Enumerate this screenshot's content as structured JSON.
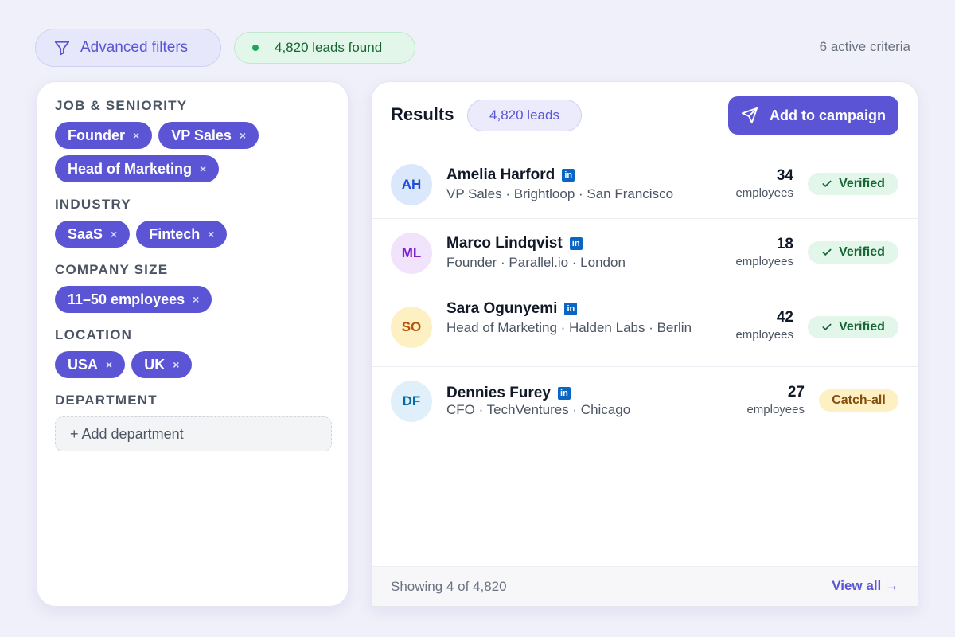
{
  "header": {
    "filters_label": "Advanced filters",
    "leads_found": "4,820 leads found",
    "active_criteria": "6 active criteria"
  },
  "filters": {
    "sections": [
      {
        "title": "JOB & SENIORITY",
        "chips": [
          "Founder",
          "VP Sales",
          "Head of Marketing"
        ]
      },
      {
        "title": "INDUSTRY",
        "chips": [
          "SaaS",
          "Fintech"
        ]
      },
      {
        "title": "COMPANY SIZE",
        "chips": [
          "11–50 employees"
        ]
      },
      {
        "title": "LOCATION",
        "chips": [
          "USA",
          "UK"
        ]
      },
      {
        "title": "DEPARTMENT",
        "chips": []
      }
    ],
    "remove_glyph": "×",
    "add_department": "+ Add department"
  },
  "results": {
    "title": "Results",
    "count_label": "4,820 leads",
    "campaign_label": "Add to campaign",
    "linkedin_glyph": "in",
    "check_glyph": "✓",
    "leads": [
      {
        "initials": "AH",
        "name": "Amelia Harford",
        "meta": "VP Sales · Brightloop · San Francisco",
        "employees": "34",
        "employees_label": "employees",
        "status": "Verified"
      },
      {
        "initials": "ML",
        "name": "Marco Lindqvist",
        "meta": "Founder · Parallel.io · London",
        "employees": "18",
        "employees_label": "employees",
        "status": "Verified"
      },
      {
        "initials": "SO",
        "name": "Sara Ogunyemi",
        "meta": "Head of Marketing · Halden Labs · Berlin",
        "employees": "42",
        "employees_label": "employees",
        "status": "Verified"
      },
      {
        "initials": "DF",
        "name": "Dennies Furey",
        "meta": "CFO · TechVentures · Chicago",
        "employees": "27",
        "employees_label": "employees",
        "status": "Catch-all"
      }
    ],
    "showing": "Showing 4 of 4,820",
    "view_all": "View all →"
  },
  "colors": {
    "accent": "#5b55d6",
    "verified_bg": "#e3f6ea",
    "verified_text": "#166534",
    "catchall_bg": "#fdf1c4",
    "catchall_text": "#854d0e",
    "linkedin": "#0a66c2"
  },
  "icons": {
    "filters": "funnel-icon",
    "campaign": "send-icon",
    "status_verified": "check-icon",
    "profile": "linkedin-icon",
    "live": "status-dot"
  }
}
